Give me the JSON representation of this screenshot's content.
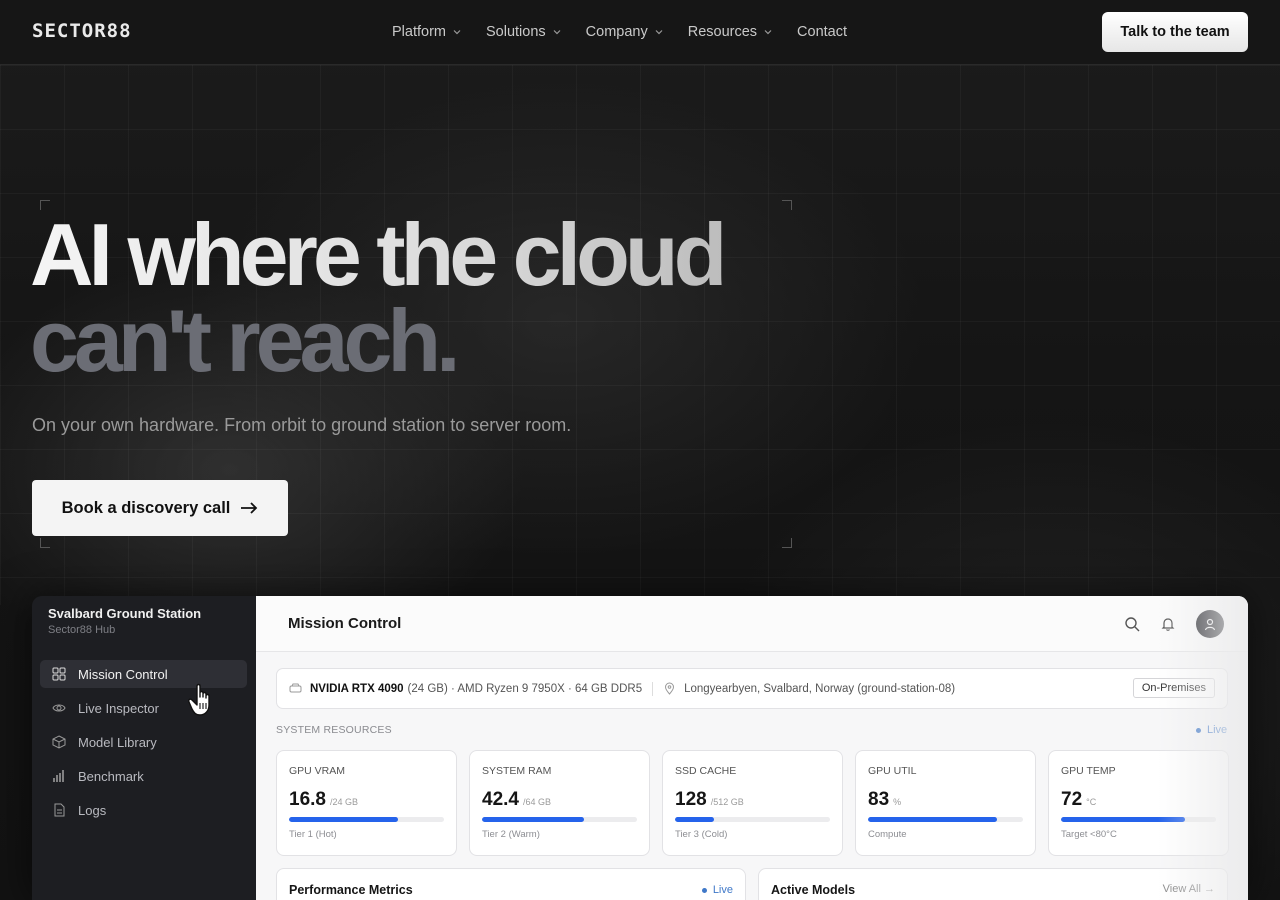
{
  "nav": {
    "logo": "SECTOR88",
    "links": [
      {
        "label": "Platform",
        "has_dropdown": true
      },
      {
        "label": "Solutions",
        "has_dropdown": true
      },
      {
        "label": "Company",
        "has_dropdown": true
      },
      {
        "label": "Resources",
        "has_dropdown": true
      },
      {
        "label": "Contact",
        "has_dropdown": false
      }
    ],
    "cta": "Talk to the team"
  },
  "hero": {
    "headline_line1": "AI where the cloud",
    "headline_line2": "can't reach.",
    "subheadline": "On your own hardware. From orbit to ground station to server room.",
    "cta": "Book a discovery call",
    "cta_icon": "arrow-right-icon"
  },
  "dashboard": {
    "sidebar": {
      "title": "Svalbard Ground Station",
      "subtitle": "Sector88 Hub",
      "items": [
        {
          "label": "Mission Control",
          "icon": "grid-icon",
          "active": true
        },
        {
          "label": "Live Inspector",
          "icon": "eye-icon",
          "active": false
        },
        {
          "label": "Model Library",
          "icon": "cube-icon",
          "active": false
        },
        {
          "label": "Benchmark",
          "icon": "bar-chart-icon",
          "active": false
        },
        {
          "label": "Logs",
          "icon": "file-icon",
          "active": false
        }
      ]
    },
    "header": {
      "title": "Mission Control",
      "icons": [
        "search-icon",
        "bell-icon",
        "user-icon"
      ]
    },
    "hardware": {
      "gpu": "NVIDIA RTX 4090",
      "spec": "(24 GB) · AMD Ryzen 9 7950X · 64 GB DDR5",
      "location": "Longyearbyen, Svalbard, Norway (ground-station-08)",
      "badge": "On-Premises"
    },
    "resources_label": "SYSTEM RESOURCES",
    "live_label": "Live",
    "cards": [
      {
        "label": "GPU VRAM",
        "value": "16.8",
        "unit": "/24 GB",
        "fill": 0.7,
        "note": "Tier 1 (Hot)"
      },
      {
        "label": "SYSTEM RAM",
        "value": "42.4",
        "unit": "/64 GB",
        "fill": 0.66,
        "note": "Tier 2 (Warm)"
      },
      {
        "label": "SSD CACHE",
        "value": "128",
        "unit": "/512 GB",
        "fill": 0.25,
        "note": "Tier 3 (Cold)"
      },
      {
        "label": "GPU UTIL",
        "value": "83",
        "unit": "%",
        "fill": 0.83,
        "note": "Compute"
      },
      {
        "label": "GPU TEMP",
        "value": "72",
        "unit": "°C",
        "fill": 0.8,
        "note": "Target <80°C"
      }
    ],
    "panels": {
      "performance_title": "Performance Metrics",
      "performance_live": "Live",
      "models_title": "Active Models",
      "models_link": "View All →"
    },
    "accent_color": "#2563eb"
  }
}
